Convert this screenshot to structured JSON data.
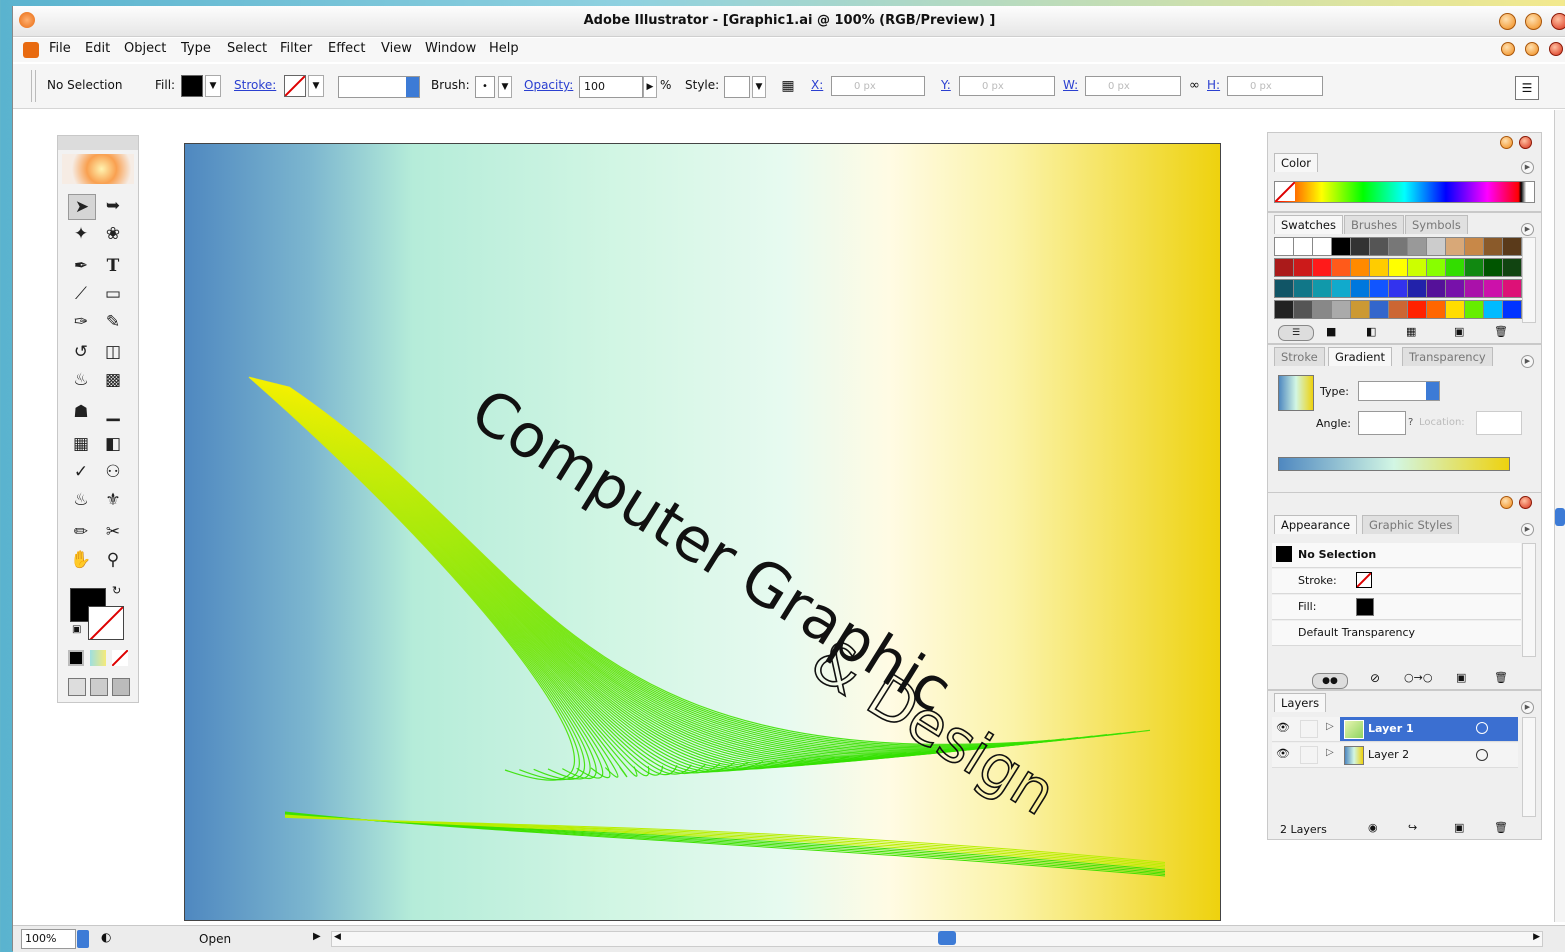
{
  "window": {
    "title": "Adobe Illustrator - [Graphic1.ai @ 100% (RGB/Preview) ]"
  },
  "menu": {
    "items": [
      "File",
      "Edit",
      "Object",
      "Type",
      "Select",
      "Filter",
      "Effect",
      "View",
      "Window",
      "Help"
    ]
  },
  "control": {
    "selection": "No Selection",
    "fill_label": "Fill:",
    "stroke_label": "Stroke:",
    "brush_label": "Brush:",
    "brush_value": "•",
    "opacity_label": "Opacity:",
    "opacity_value": "100",
    "percent": "%",
    "style_label": "Style:",
    "x_label": "X:",
    "x_value": "0 px",
    "y_label": "Y:",
    "y_value": "0 px",
    "w_label": "W:",
    "w_value": "0 px",
    "h_label": "H:",
    "h_value": "0 px"
  },
  "artboard": {
    "line1": "Computer Graphic",
    "line2": "& Design",
    "colors": {
      "left": "#4f88c0",
      "mid": "#d2f6e4",
      "right": "#eed20e",
      "lines_start": "#f4f000",
      "lines_end": "#33e000"
    }
  },
  "color_panel": {
    "tab": "Color"
  },
  "swatches_panel": {
    "tabs": [
      "Swatches",
      "Brushes",
      "Symbols"
    ]
  },
  "gradient_panel": {
    "tabs": [
      "Stroke",
      "Gradient",
      "Transparency"
    ],
    "type_label": "Type:",
    "angle_label": "Angle:",
    "location_label": "Location:",
    "question": "?"
  },
  "appearance_panel": {
    "tabs": [
      "Appearance",
      "Graphic Styles"
    ],
    "rows": [
      "No Selection",
      "Stroke:",
      "Fill:",
      "Default Transparency"
    ]
  },
  "layers_panel": {
    "tab": "Layers",
    "layers": [
      "Layer 1",
      "Layer 2"
    ],
    "count": "2 Layers"
  },
  "status": {
    "zoom": "100%",
    "state": "Open"
  }
}
